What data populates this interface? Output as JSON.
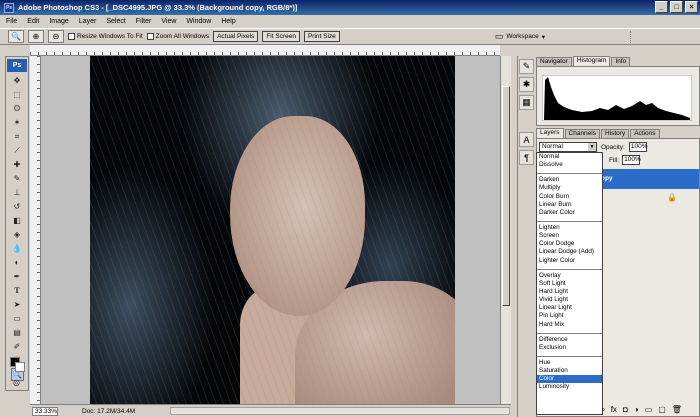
{
  "window": {
    "title": "Adobe Photoshop CS3 - [_DSC4995.JPG @ 33.3% (Background copy, RGB/8*)]",
    "app_badge": "Ps",
    "min": "_",
    "max": "□",
    "close": "×"
  },
  "menu": [
    "File",
    "Edit",
    "Image",
    "Layer",
    "Select",
    "Filter",
    "View",
    "Window",
    "Help"
  ],
  "options": {
    "resize_windows": "Resize Windows To Fit",
    "zoom_all": "Zoom All Windows",
    "actual_pixels": "Actual Pixels",
    "fit_screen": "Fit Screen",
    "print_size": "Print Size",
    "workspace": "Workspace"
  },
  "toolbox": {
    "logo": "Ps"
  },
  "status": {
    "zoom": "33.33%",
    "doc": "Doc: 17.2M/34.4M"
  },
  "top_panel": {
    "tabs": [
      "Navigator",
      "Histogram",
      "Info"
    ],
    "active": 1
  },
  "layers_panel": {
    "tabs": [
      "Layers",
      "Channels",
      "History",
      "Actions"
    ],
    "blend_mode": "Normal",
    "opacity_label": "Opacity:",
    "opacity": "100%",
    "fill_label": "Fill:",
    "fill": "100%",
    "selected_layer": "opy"
  },
  "blend_modes": {
    "group1": [
      "Normal",
      "Dissolve"
    ],
    "group2": [
      "Darken",
      "Multiply",
      "Color Burn",
      "Linear Burn",
      "Darker Color"
    ],
    "group3": [
      "Lighten",
      "Screen",
      "Color Dodge",
      "Linear Dodge (Add)",
      "Lighter Color"
    ],
    "group4": [
      "Overlay",
      "Soft Light",
      "Hard Light",
      "Vivid Light",
      "Linear Light",
      "Pin Light",
      "Hard Mix"
    ],
    "group5": [
      "Difference",
      "Exclusion"
    ],
    "group6": [
      "Hue",
      "Saturation",
      "Color",
      "Luminosity"
    ],
    "highlighted": "Color"
  },
  "colors": {
    "title_bar": "#0a246a",
    "highlight": "#2a6cc8",
    "chrome": "#d4d0c8"
  }
}
